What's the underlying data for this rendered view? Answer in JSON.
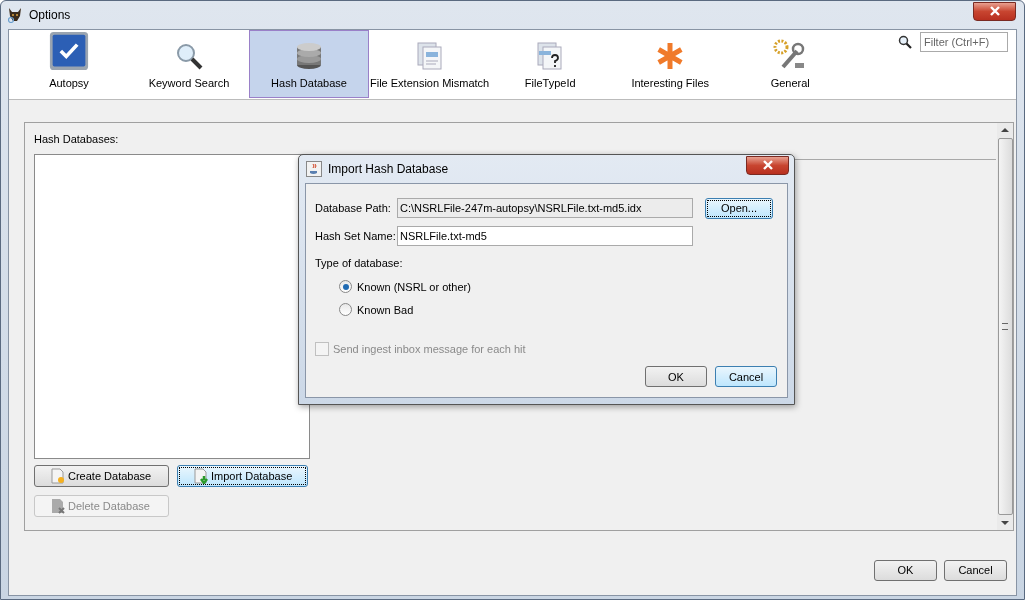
{
  "window": {
    "title": "Options"
  },
  "filter": {
    "placeholder": "Filter (Ctrl+F)"
  },
  "categories": [
    {
      "label": "Autopsy",
      "kind": "autopsy",
      "selected": false
    },
    {
      "label": "Keyword Search",
      "kind": "search",
      "selected": false
    },
    {
      "label": "Hash Database",
      "kind": "database",
      "selected": true
    },
    {
      "label": "File Extension Mismatch",
      "kind": "files",
      "selected": false
    },
    {
      "label": "FileTypeId",
      "kind": "filetype",
      "selected": false
    },
    {
      "label": "Interesting Files",
      "kind": "asterisk",
      "selected": false
    },
    {
      "label": "General",
      "kind": "tools",
      "selected": false
    }
  ],
  "hash_panel": {
    "label": "Hash Databases:",
    "buttons": [
      {
        "label": "Create Database",
        "kind": "create",
        "disabled": false,
        "focused": false
      },
      {
        "label": "Import Database",
        "kind": "import",
        "disabled": false,
        "focused": true
      },
      {
        "label": "Delete Database",
        "kind": "delete",
        "disabled": true,
        "focused": false
      }
    ]
  },
  "dialog": {
    "title": "Import Hash Database",
    "fields": [
      {
        "label": "Database Path:",
        "value": "C:\\NSRLFile-247m-autopsy\\NSRLFile.txt-md5.idx",
        "editable": false
      },
      {
        "label": "Hash Set Name:",
        "value": "NSRLFile.txt-md5",
        "editable": true
      }
    ],
    "open_button": "Open...",
    "type_label": "Type of database:",
    "types": [
      {
        "label": "Known (NSRL or other)",
        "selected": true
      },
      {
        "label": "Known Bad",
        "selected": false
      }
    ],
    "send_message": {
      "label": "Send ingest inbox message for each hit",
      "checked": false,
      "disabled": true
    },
    "buttons": [
      {
        "label": "OK",
        "default": false
      },
      {
        "label": "Cancel",
        "default": true
      }
    ]
  },
  "buttons": [
    "OK",
    "Cancel"
  ]
}
